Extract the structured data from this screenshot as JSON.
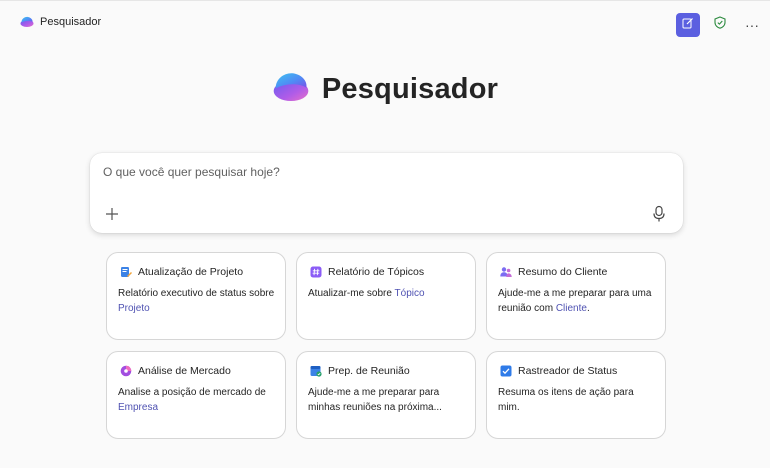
{
  "app": {
    "name": "Pesquisador",
    "hero_title": "Pesquisador"
  },
  "search": {
    "placeholder": "O que você quer pesquisar hoje?"
  },
  "colors": {
    "accent": "#5b5fe0",
    "link": "#4f52b2",
    "shield": "#2b8a3e"
  },
  "icons": {
    "new_chat": "compose-icon",
    "shield": "shield-check-icon",
    "more": "more-horizontal-icon",
    "add": "plus-icon",
    "mic": "microphone-icon"
  },
  "cards": [
    {
      "title": "Atualização de Projeto",
      "icon": "document-edit-icon",
      "text": "Relatório executivo de status sobre ",
      "link": "Projeto",
      "suffix": ""
    },
    {
      "title": "Relatório de Tópicos",
      "icon": "hashtag-icon",
      "text": "Atualizar-me sobre ",
      "link": "Tópico",
      "suffix": ""
    },
    {
      "title": "Resumo do Cliente",
      "icon": "people-icon",
      "text": "Ajude-me a me preparar para uma reunião com ",
      "link": "Cliente",
      "suffix": "."
    },
    {
      "title": "Análise de Mercado",
      "icon": "market-icon",
      "text": "Analise a posição de mercado de ",
      "link": "Empresa",
      "suffix": ""
    },
    {
      "title": "Prep. de Reunião",
      "icon": "calendar-icon",
      "text": "Ajude-me a me preparar para minhas reuniões na próxima...",
      "link": "",
      "suffix": ""
    },
    {
      "title": "Rastreador de Status",
      "icon": "checkbox-icon",
      "text": "Resuma os itens de ação para mim.",
      "link": "",
      "suffix": ""
    }
  ]
}
